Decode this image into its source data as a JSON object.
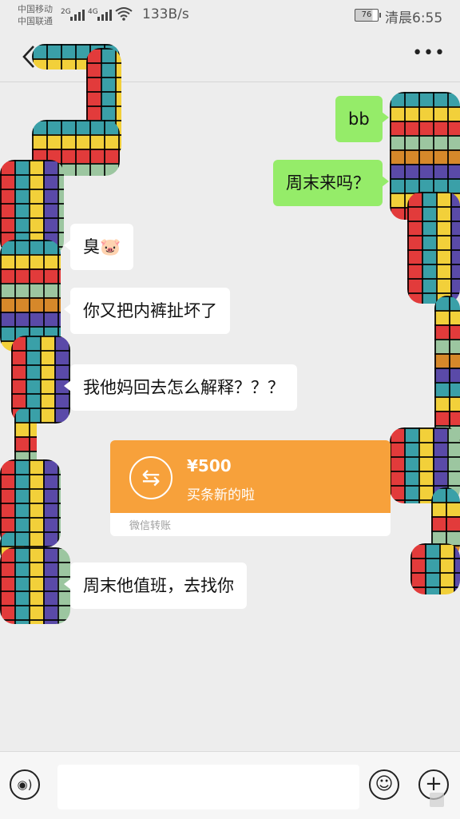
{
  "status_bar": {
    "carrier1": "中国移动",
    "carrier2": "中国联通",
    "net1": "2G",
    "net2": "4G",
    "speed": "133B/s",
    "battery": "76",
    "time": "清晨6:55"
  },
  "nav": {
    "back_icon": "chevron-left-icon",
    "more_icon": "more-dots-icon",
    "more_label": "•••"
  },
  "messages": [
    {
      "side": "right",
      "text": "bb"
    },
    {
      "side": "right",
      "text": "周末来吗？"
    },
    {
      "side": "left",
      "text": "臭🐷"
    },
    {
      "side": "left",
      "text": "你又把内裤扯坏了"
    },
    {
      "side": "left",
      "text": "我他妈回去怎么解释？？？"
    },
    {
      "side": "left",
      "text": "周末他值班，去找你"
    }
  ],
  "transfer": {
    "amount": "¥500",
    "note": "买条新的啦",
    "footer": "微信转账",
    "icon": "transfer-arrows-icon",
    "icon_glyph": "⇆",
    "color": "#f7a13b"
  },
  "input_bar": {
    "voice_icon": "voice-icon",
    "voice_glyph": "◉)",
    "emoji_icon": "emoji-icon",
    "emoji_glyph": "☺",
    "plus_icon": "plus-icon",
    "plus_glyph": "+",
    "placeholder": ""
  },
  "colors": {
    "outgoing_bubble": "#95ec69",
    "incoming_bubble": "#ffffff",
    "background": "#ededed"
  }
}
